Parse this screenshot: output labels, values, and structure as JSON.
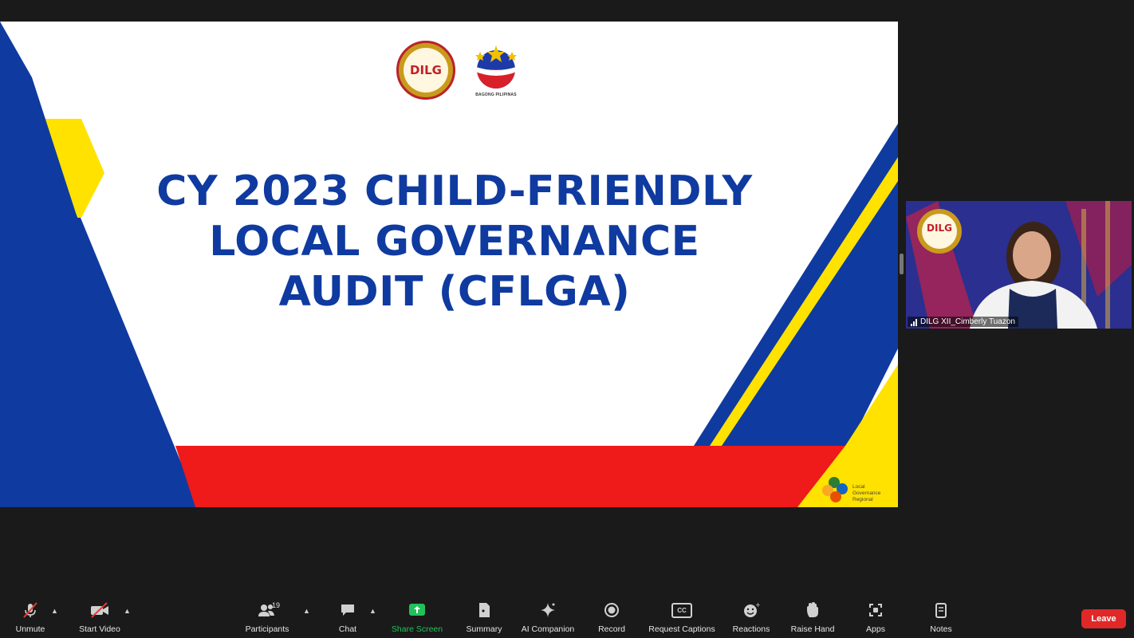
{
  "slide": {
    "title_lines": [
      "CY 2023 CHILD-FRIENDLY",
      "LOCAL GOVERNANCE",
      "AUDIT (CFLGA)"
    ],
    "logo_dilg_text": "DILG",
    "logo_bp_caption": "BAGONG PILIPINAS",
    "corner_logo_text": [
      "Local",
      "Governance",
      "Regional"
    ],
    "colors": {
      "blue": "#0f3aa0",
      "yellow": "#ffe200",
      "red": "#ef1a1a"
    }
  },
  "participant": {
    "name": "DILG XII_Cimberly Tuazon",
    "logo_text": "DILG"
  },
  "toolbar": {
    "unmute": "Unmute",
    "start_video": "Start Video",
    "participants": "Participants",
    "participant_count": "19",
    "chat": "Chat",
    "share_screen": "Share Screen",
    "summary": "Summary",
    "ai_companion": "AI Companion",
    "record": "Record",
    "request_captions": "Request Captions",
    "cc_icon_text": "CC",
    "reactions": "Reactions",
    "raise_hand": "Raise Hand",
    "apps": "Apps",
    "notes": "Notes",
    "leave": "Leave",
    "accent_green": "#20c15a",
    "leave_color": "#e02828"
  }
}
